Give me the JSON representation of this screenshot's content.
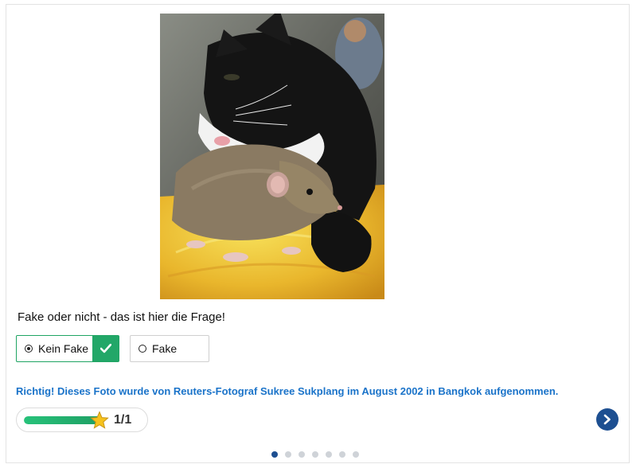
{
  "question": "Fake oder nicht - das ist hier die Frage!",
  "options": [
    {
      "label": "Kein Fake",
      "selected": true,
      "correct": true
    },
    {
      "label": "Fake",
      "selected": false
    }
  ],
  "feedback": "Richtig! Dieses Foto wurde von Reuters-Fotograf Sukree Sukplang im August 2002 in Bangkok aufgenommen.",
  "progress": {
    "text": "1/1",
    "fraction": 1.0
  },
  "pagination": {
    "total": 7,
    "active_index": 0
  },
  "icons": {
    "check": "check-icon",
    "star": "star-icon",
    "next": "chevron-right-icon"
  },
  "colors": {
    "correct_green": "#22a768",
    "feedback_blue": "#1a73c9",
    "nav_blue": "#1d4f91",
    "star_yellow": "#f6c21c"
  }
}
